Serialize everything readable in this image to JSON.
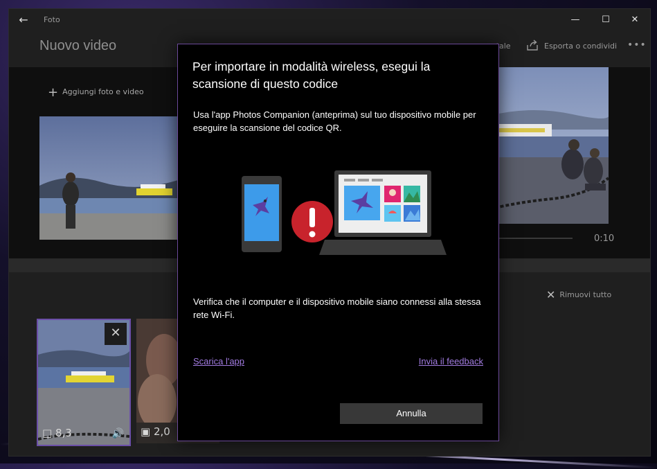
{
  "app": {
    "title": "Foto",
    "back_icon": "back-arrow-icon",
    "window_controls": [
      "minimize-icon",
      "maximize-icon",
      "close-icon"
    ]
  },
  "header": {
    "title": "Nuovo video",
    "orientation_label": "ontale",
    "export_label": "Esporta o condividi",
    "more_icon": "more-icon"
  },
  "library": {
    "add_label": "Aggiungi foto e video"
  },
  "preview": {
    "time": "0:10"
  },
  "storyboard": {
    "remove_all_label": "Rimuovi tutto",
    "cards": [
      {
        "duration": "8,3"
      },
      {
        "duration": "2,0"
      }
    ]
  },
  "dialog": {
    "title": "Per importare in modalità wireless, esegui la scansione di questo codice",
    "body": "Usa l'app Photos Companion (anteprima) sul tuo dispositivo mobile per eseguire la scansione del codice QR.",
    "note": "Verifica che il computer e il dispositivo mobile siano connessi alla stessa rete Wi-Fi.",
    "link_download": "Scarica l'app",
    "link_feedback": "Invia il feedback",
    "cancel_label": "Annulla",
    "accent_color": "#a17be0",
    "error_color": "#c8232c"
  }
}
